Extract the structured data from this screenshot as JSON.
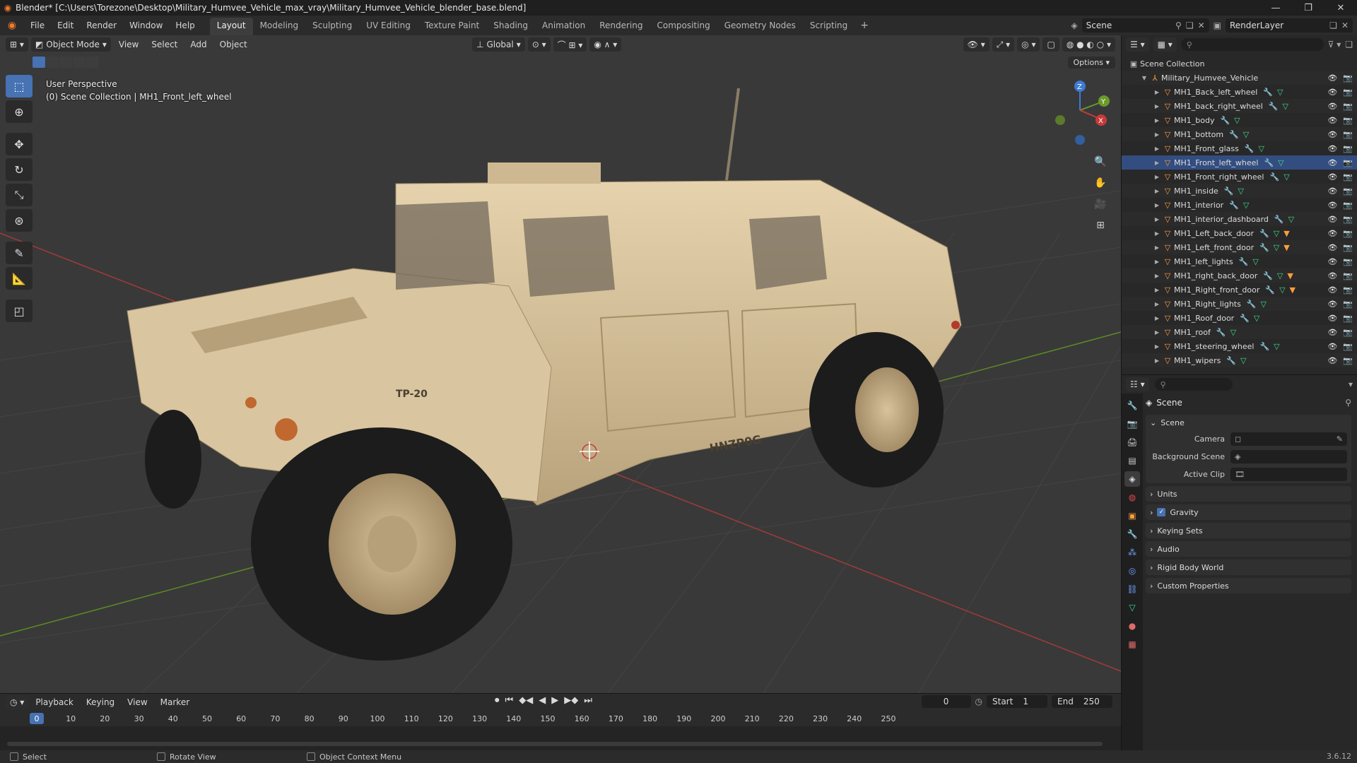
{
  "titlebar": {
    "title": "Blender* [C:\\Users\\Torezone\\Desktop\\Military_Humvee_Vehicle_max_vray\\Military_Humvee_Vehicle_blender_base.blend]"
  },
  "menu": {
    "items": [
      "File",
      "Edit",
      "Render",
      "Window",
      "Help"
    ],
    "workspaces": [
      "Layout",
      "Modeling",
      "Sculpting",
      "UV Editing",
      "Texture Paint",
      "Shading",
      "Animation",
      "Rendering",
      "Compositing",
      "Geometry Nodes",
      "Scripting"
    ],
    "active_workspace": "Layout",
    "scene": "Scene",
    "view_layer": "RenderLayer"
  },
  "viewport": {
    "mode": "Object Mode",
    "menus": [
      "View",
      "Select",
      "Add",
      "Object"
    ],
    "transform_orientation": "Global",
    "options_label": "Options",
    "info_line1": "User Perspective",
    "info_line2": "(0) Scene Collection | MH1_Front_left_wheel",
    "plate_text": "TP-20",
    "side_text": "HNZP0G"
  },
  "outliner": {
    "root": "Scene Collection",
    "collection": "Military_Humvee_Vehicle",
    "items": [
      {
        "name": "MH1_Back_left_wheel",
        "mat": false
      },
      {
        "name": "MH1_back_right_wheel",
        "mat": false
      },
      {
        "name": "MH1_body",
        "mat": false
      },
      {
        "name": "MH1_bottom",
        "mat": false
      },
      {
        "name": "MH1_Front_glass",
        "mat": false
      },
      {
        "name": "MH1_Front_left_wheel",
        "mat": false
      },
      {
        "name": "MH1_Front_right_wheel",
        "mat": false
      },
      {
        "name": "MH1_inside",
        "mat": false
      },
      {
        "name": "MH1_interior",
        "mat": false
      },
      {
        "name": "MH1_interior_dashboard",
        "mat": false
      },
      {
        "name": "MH1_Left_back_door",
        "mat": true
      },
      {
        "name": "MH1_Left_front_door",
        "mat": true
      },
      {
        "name": "MH1_left_lights",
        "mat": false
      },
      {
        "name": "MH1_right_back_door",
        "mat": true
      },
      {
        "name": "MH1_Right_front_door",
        "mat": true
      },
      {
        "name": "MH1_Right_lights",
        "mat": false
      },
      {
        "name": "MH1_Roof_door",
        "mat": false
      },
      {
        "name": "MH1_roof",
        "mat": false
      },
      {
        "name": "MH1_steering_wheel",
        "mat": false
      },
      {
        "name": "MH1_wipers",
        "mat": false
      }
    ]
  },
  "properties": {
    "context": "Scene",
    "panel_title": "Scene",
    "rows": [
      {
        "label": "Camera"
      },
      {
        "label": "Background Scene"
      },
      {
        "label": "Active Clip"
      }
    ],
    "collapsed": [
      "Units",
      "Gravity",
      "Keying Sets",
      "Audio",
      "Rigid Body World",
      "Custom Properties"
    ]
  },
  "timeline": {
    "menus": [
      "Playback",
      "Keying",
      "View",
      "Marker"
    ],
    "current_frame": "0",
    "start_label": "Start",
    "start": "1",
    "end_label": "End",
    "end": "250",
    "ticks": [
      "0",
      "10",
      "20",
      "30",
      "40",
      "50",
      "60",
      "70",
      "80",
      "90",
      "100",
      "110",
      "120",
      "130",
      "140",
      "150",
      "160",
      "170",
      "180",
      "190",
      "200",
      "210",
      "220",
      "230",
      "240",
      "250"
    ]
  },
  "statusbar": {
    "select": "Select",
    "rotate": "Rotate View",
    "context_menu": "Object Context Menu",
    "version": "3.6.12"
  },
  "colors": {
    "accent": "#4772b3",
    "selection_row": "#334d80",
    "vehicle_tan": "#d8c19a",
    "axis_red": "#b03a3a",
    "axis_green": "#6a9a2a"
  }
}
